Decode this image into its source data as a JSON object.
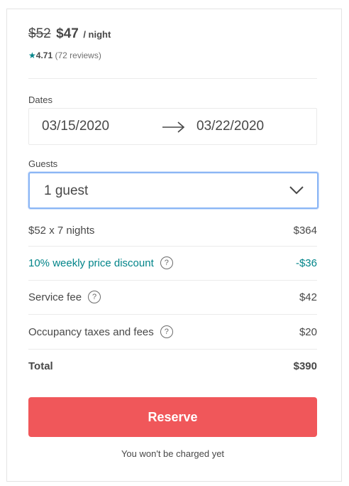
{
  "listing": {
    "old_price": "$52",
    "new_price": "$47",
    "per_night": "/ night",
    "star_symbol": "★",
    "rating": "4.71",
    "reviews": "(72 reviews)"
  },
  "dates": {
    "label": "Dates",
    "check_in": "03/15/2020",
    "check_out": "03/22/2020"
  },
  "guests": {
    "label": "Guests",
    "selected": "1 guest"
  },
  "price_breakdown": {
    "nightly": {
      "label": "$52 x 7 nights",
      "amount": "$364"
    },
    "discount": {
      "label": "10% weekly price discount",
      "amount": "-$36"
    },
    "service_fee": {
      "label": "Service fee",
      "amount": "$42"
    },
    "taxes": {
      "label": "Occupancy taxes and fees",
      "amount": "$20"
    },
    "total": {
      "label": "Total",
      "amount": "$390"
    },
    "help_symbol": "?"
  },
  "reserve": {
    "button_label": "Reserve",
    "note": "You won't be charged yet"
  },
  "colors": {
    "accent_teal": "#008489",
    "reserve_red": "#f0575a",
    "focus_blue": "#8bb6f5"
  }
}
